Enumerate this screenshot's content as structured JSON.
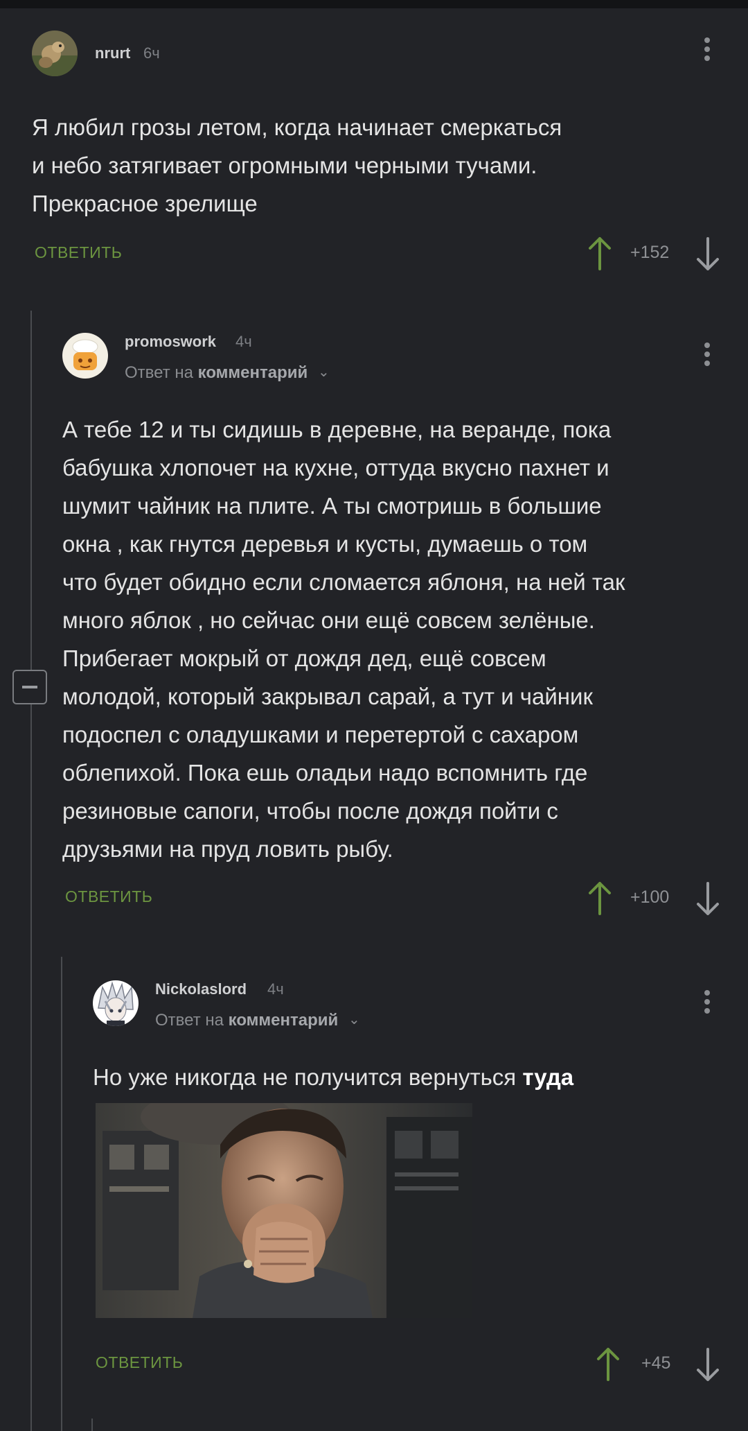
{
  "comments": [
    {
      "author": "nrurt",
      "time": "6ч",
      "text_lines": [
        "Я любил грозы летом, когда начинает смеркаться",
        "и небо затягивает огромными черными тучами.",
        "Прекрасное зрелище"
      ],
      "reply_label": "ОТВЕТИТЬ",
      "rating": "+152"
    },
    {
      "author": "promoswork",
      "time": "4ч",
      "reply_prefix": "Ответ на",
      "reply_target": "комментарий",
      "text_lines": [
        "А тебе 12 и ты сидишь в деревне, на веранде, пока",
        "бабушка хлопочет на кухне, оттуда вкусно пахнет и",
        "шумит чайник на плите. А ты смотришь в большие",
        "окна , как гнутся деревья и кусты, думаешь о том",
        "что будет обидно если сломается яблоня, на ней так",
        "много яблок , но сейчас они ещё совсем зелёные.",
        "Прибегает мокрый от дождя дед, ещё совсем",
        "молодой, который закрывал сарай, а тут и чайник",
        "подоспел с оладушками и перетертой с сахаром",
        "облепихой. Пока ешь оладьи надо вспомнить где",
        "резиновые сапоги, чтобы после дождя пойти с",
        "друзьями на пруд ловить рыбу."
      ],
      "reply_label": "ОТВЕТИТЬ",
      "rating": "+100"
    },
    {
      "author": "Nickolaslord",
      "time": "4ч",
      "reply_prefix": "Ответ на",
      "reply_target": "комментарий",
      "text_normal": "Но уже никогда не получится вернуться ",
      "text_bold": "туда",
      "reply_label": "ОТВЕТИТЬ",
      "rating": "+45"
    }
  ],
  "colors": {
    "background": "#222327",
    "reply_button": "#6c9540",
    "upvote": "#6c9540",
    "downvote": "#9a9ca0"
  },
  "icons": {
    "upvote": "arrow-up-icon",
    "downvote": "arrow-down-icon",
    "menu": "kebab-menu-icon",
    "collapse": "collapse-minus-icon",
    "expand_reply": "chevron-down-icon"
  }
}
